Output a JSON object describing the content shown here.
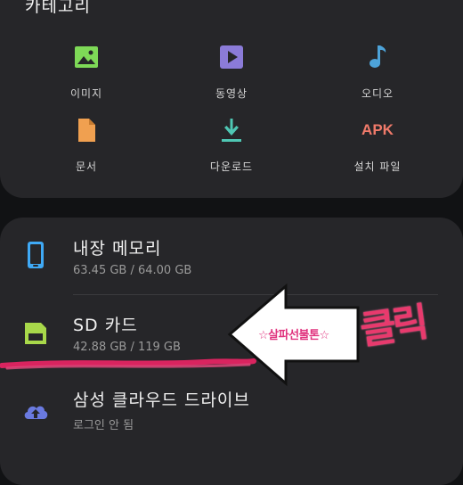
{
  "categories": {
    "title": "카테고리",
    "items": [
      {
        "label": "이미지",
        "icon": "image-icon",
        "color": "#7ed957"
      },
      {
        "label": "동영상",
        "icon": "video-icon",
        "color": "#8b7bd8"
      },
      {
        "label": "오디오",
        "icon": "music-note-icon",
        "color": "#4da3d9"
      },
      {
        "label": "문서",
        "icon": "document-icon",
        "color": "#f0a050"
      },
      {
        "label": "다운로드",
        "icon": "download-icon",
        "color": "#4fc7b4"
      },
      {
        "label": "설치 파일",
        "icon": "apk-icon",
        "color": "#f07a6a",
        "icon_text": "APK"
      }
    ]
  },
  "storage": {
    "items": [
      {
        "title": "내장 메모리",
        "subtitle": "63.45 GB / 64.00 GB",
        "icon": "phone-icon",
        "color": "#3fa9f5"
      },
      {
        "title": "SD 카드",
        "subtitle": "42.88 GB / 119 GB",
        "icon": "sd-card-icon",
        "color": "#a8d84a"
      },
      {
        "title": "삼성 클라우드 드라이브",
        "subtitle": "로그인 안 됨",
        "icon": "cloud-upload-icon",
        "color": "#6a7ae0"
      }
    ]
  },
  "annotation": {
    "arrow_text": "☆살파선불톤☆",
    "click_text": "클릭",
    "color": "#e0337e"
  }
}
